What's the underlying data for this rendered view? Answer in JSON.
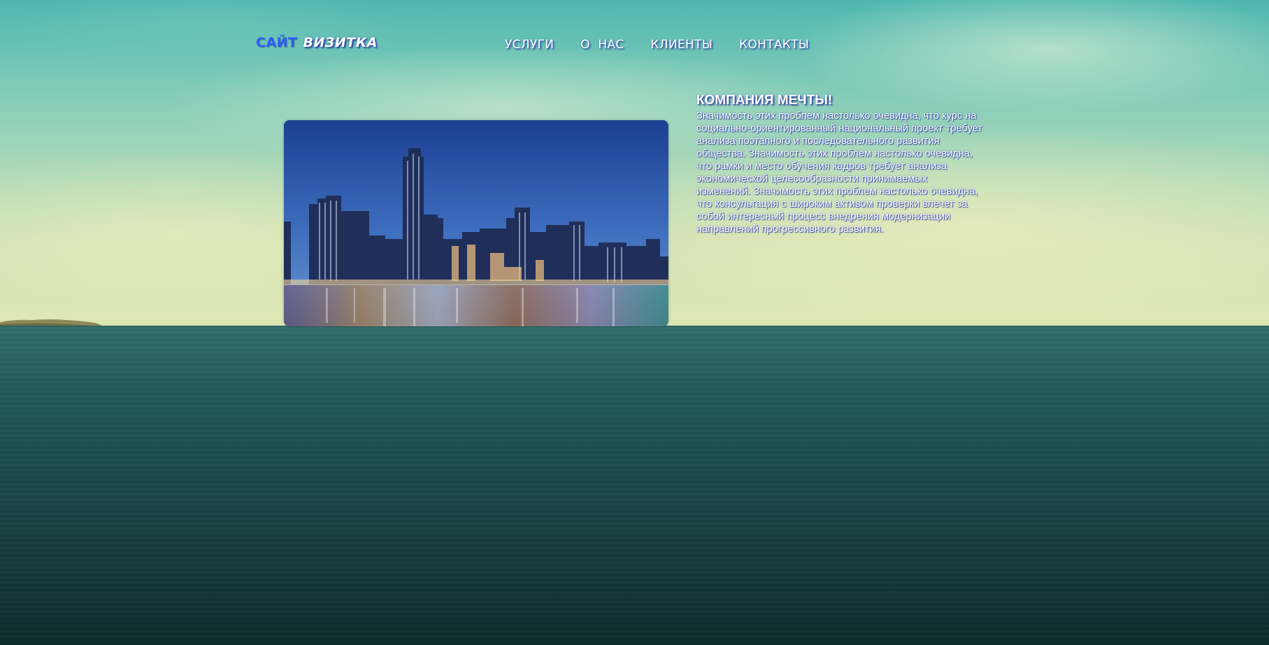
{
  "header": {
    "logo_part1": "САЙТ",
    "logo_part2": "ВИЗИТКА",
    "nav": [
      {
        "label": "УСЛУГИ"
      },
      {
        "label": "О  НАС"
      },
      {
        "label": "КЛИЕНТЫ"
      },
      {
        "label": "КОНТАКТЫ"
      }
    ]
  },
  "main": {
    "image_name": "city-skyline-photo",
    "title": "КОМПАНИЯ МЕЧТЫ!",
    "text": "Значимость этих проблем настолько очевидна, что курс на социально-ориентированный национальный проект требует анализа поэтапного и последовательного развития общества. Значимость этих проблем настолько очевидна, что рамки и место обучения кадров требует анализа экономической целесообразности принимаемых изменений. Значимость этих проблем настолько очевидна, что консультация с широким активом проверки влечет за собой интересный процесс внедрения модернизации направлений прогрессивного развития."
  },
  "colors": {
    "logo_accent": "#2b5bff",
    "text": "#ffffff",
    "text_shadow": "#2f3fa0",
    "sea": "#1b4a4b",
    "sky": "#7ccab8"
  }
}
